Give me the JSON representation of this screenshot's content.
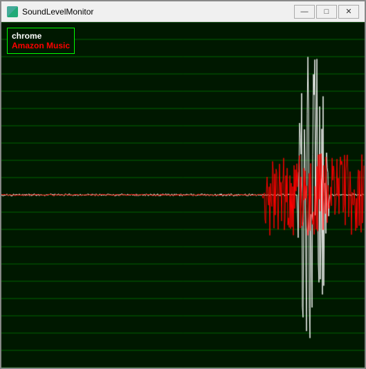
{
  "window": {
    "title": "SoundLevelMonitor",
    "title_icon_color": "#44aa88"
  },
  "titlebar": {
    "minimize_label": "—",
    "maximize_label": "□",
    "close_label": "✕"
  },
  "legend": {
    "chrome_label": "chrome",
    "amazon_label": "Amazon Music",
    "chrome_color": "#ffffff",
    "amazon_color": "#ff0000"
  },
  "monitor": {
    "background": "#001800",
    "grid_color": "#006600",
    "grid_lines": 20
  }
}
